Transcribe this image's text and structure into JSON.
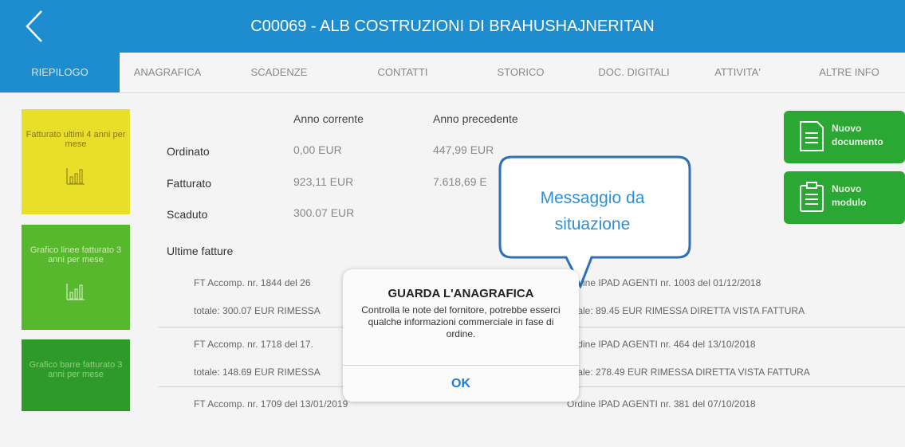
{
  "header": {
    "title": "C00069 - ALB COSTRUZIONI DI BRAHUSHAJNERITAN",
    "back_icon": "chevron-left-icon"
  },
  "tabs": [
    {
      "label": "RIEPILOGO",
      "active": true
    },
    {
      "label": "ANAGRAFICA"
    },
    {
      "label": "SCADENZE"
    },
    {
      "label": "CONTATTI"
    },
    {
      "label": "STORICO"
    },
    {
      "label": "DOC. DIGITALI"
    },
    {
      "label": "ATTIVITA'"
    },
    {
      "label": "ALTRE INFO"
    }
  ],
  "side_tiles": [
    {
      "label": "Fatturato ultimi 4 anni per mese",
      "icon": "bar-chart-icon",
      "color": "#e8df2a"
    },
    {
      "label": "Grafico linee fatturato 3 anni per mese",
      "icon": "bar-chart-icon",
      "color": "#57b82e"
    },
    {
      "label": "Grafico barre fatturato 3 anni per mese",
      "icon": "bar-chart-icon",
      "color": "#2e9a2a"
    }
  ],
  "summary": {
    "col_current": "Anno corrente",
    "col_previous": "Anno precedente",
    "rows": [
      {
        "label": "Ordinato",
        "current": "0,00 EUR",
        "previous": "447,99 EUR"
      },
      {
        "label": "Fatturato",
        "current": "923,11 EUR",
        "previous": "7.618,69 E"
      },
      {
        "label": "Scaduto",
        "current": "300.07 EUR",
        "previous": ""
      }
    ]
  },
  "actions": [
    {
      "label_1": "Nuovo",
      "label_2": "documento",
      "icon": "document-icon"
    },
    {
      "label_1": "Nuovo",
      "label_2": "modulo",
      "icon": "clipboard-icon"
    }
  ],
  "invoices": {
    "title": "Ultime fatture",
    "rows": [
      {
        "doc": "FT Accomp. nr. 1844   del 26",
        "total": "totale: 300.07 EUR   RIMESSA",
        "order": "Ordine IPAD AGENTI nr. 1003 del 01/12/2018",
        "order_total": "totale: 89.45 EUR   RIMESSA DIRETTA VISTA FATTURA"
      },
      {
        "doc": "FT Accomp. nr. 1718   del 17.",
        "total": "totale: 148.69 EUR   RIMESSA",
        "order": "Ordine IPAD AGENTI nr. 464 del 13/10/2018",
        "order_total": "totale: 278.49 EUR   RIMESSA DIRETTA VISTA FATTURA"
      },
      {
        "doc": "FT Accomp. nr. 1709   del 13/01/2019",
        "total": "",
        "order": "Ordine IPAD AGENTI nr. 381 del 07/10/2018",
        "order_total": ""
      }
    ]
  },
  "dialog": {
    "title": "GUARDA L'ANAGRAFICA",
    "message": "Controlla le note del fornitore, potrebbe esserci qualche informazioni commerciale in fase di ordine.",
    "ok_label": "OK"
  },
  "callout": {
    "line_1": "Messaggio da",
    "line_2": "situazione"
  },
  "colors": {
    "accent": "#1e8dd0",
    "action_green": "#2aa833",
    "link_blue": "#1a7ee0"
  }
}
